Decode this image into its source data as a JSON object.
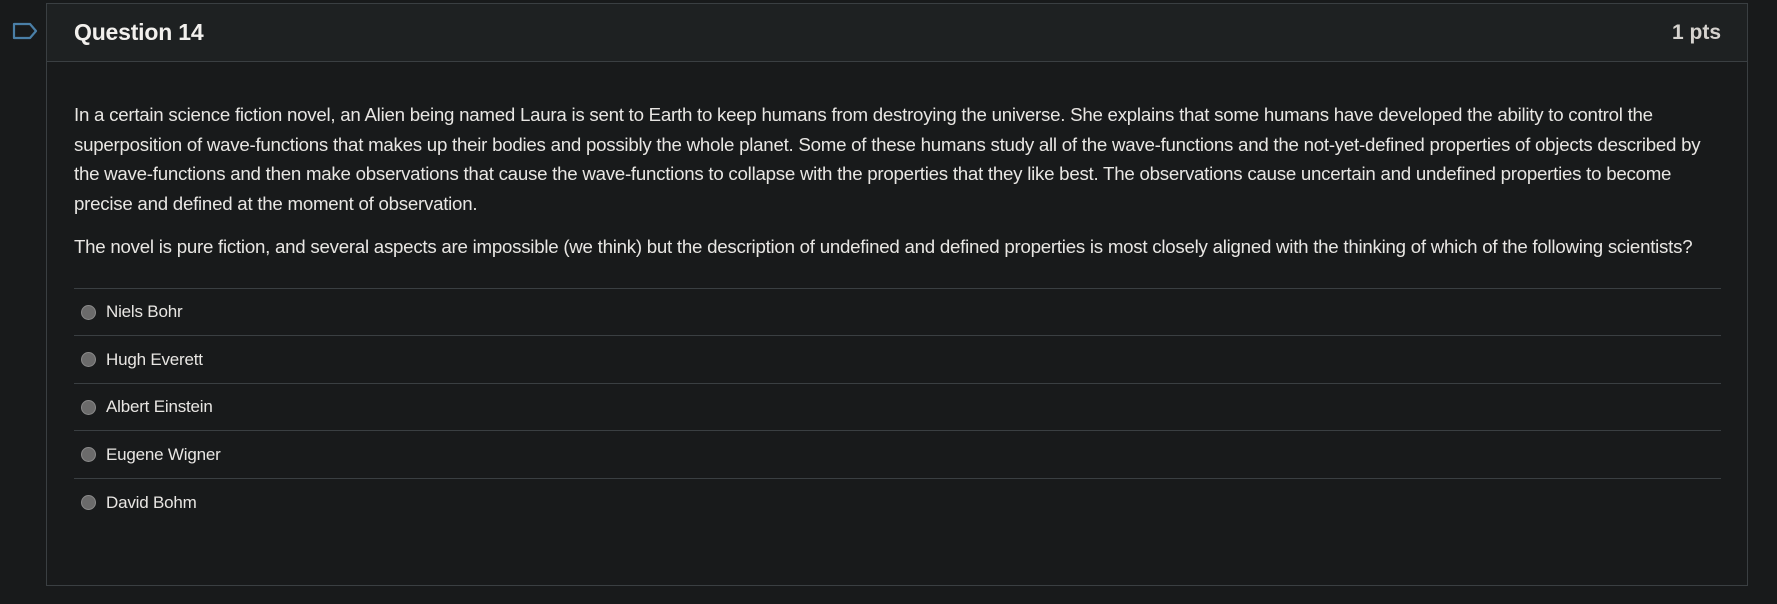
{
  "flag_icon": "bookmark-flag-icon",
  "accent_color": "#4a7fa7",
  "question": {
    "title": "Question 14",
    "points": "1 pts",
    "paragraphs": [
      "In a certain science fiction novel, an Alien being named Laura is sent to Earth to keep humans from destroying the universe.  She explains that some humans have developed the ability to control the superposition of wave-functions that makes up their bodies and possibly the whole planet.  Some of these humans study all of the wave-functions and the not-yet-defined properties of objects described by the wave-functions and then make observations that cause the wave-functions to collapse with the properties that they like best. The observations cause uncertain and undefined properties to become precise and defined at the moment of observation.",
      "The novel is pure fiction, and several aspects are impossible (we think) but the description of undefined and defined properties is most closely aligned with the thinking of which of the following scientists?"
    ],
    "answers": [
      {
        "label": "Niels Bohr"
      },
      {
        "label": "Hugh Everett"
      },
      {
        "label": "Albert Einstein"
      },
      {
        "label": "Eugene Wigner"
      },
      {
        "label": "David Bohm"
      }
    ]
  }
}
